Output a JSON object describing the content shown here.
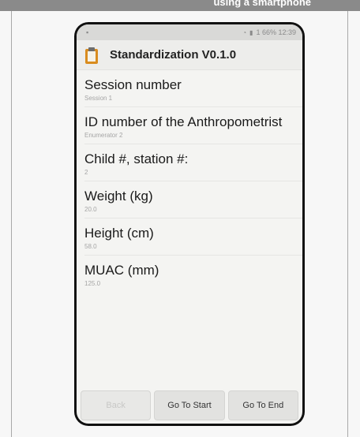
{
  "banner": {
    "text": "using a smartphone"
  },
  "app": {
    "title": "Standardization V0.1.0"
  },
  "status_bar": {
    "text": "1 66% 12:39"
  },
  "fields": [
    {
      "label": "Session number",
      "value": "Session 1"
    },
    {
      "label": "ID number of the Anthropometrist",
      "value": "Enumerator 2"
    },
    {
      "label": "Child #, station #:",
      "value": "2"
    },
    {
      "label": "Weight (kg)",
      "value": "20.0"
    },
    {
      "label": "Height (cm)",
      "value": "58.0"
    },
    {
      "label": "MUAC (mm)",
      "value": "125.0"
    }
  ],
  "buttons": {
    "back": "Back",
    "go_start": "Go To Start",
    "go_end": "Go To End"
  }
}
